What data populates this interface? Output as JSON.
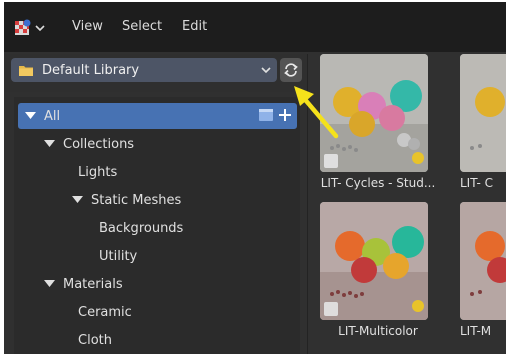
{
  "menubar": {
    "items": [
      "View",
      "Select",
      "Edit"
    ]
  },
  "library": {
    "selected": "Default Library"
  },
  "tree": {
    "all": "All",
    "collections": "Collections",
    "lights": "Lights",
    "static_meshes": "Static Meshes",
    "backgrounds": "Backgrounds",
    "utility": "Utility",
    "materials": "Materials",
    "ceramic": "Ceramic",
    "cloth": "Cloth"
  },
  "assets": [
    {
      "label": "LIT- Cycles - Stud..."
    },
    {
      "label": "LIT- C"
    },
    {
      "label": "LIT-Multicolor"
    },
    {
      "label": "LIT-M"
    }
  ],
  "colors": {
    "accent": "#4772b3",
    "annotation_arrow": "#f5e21b"
  }
}
